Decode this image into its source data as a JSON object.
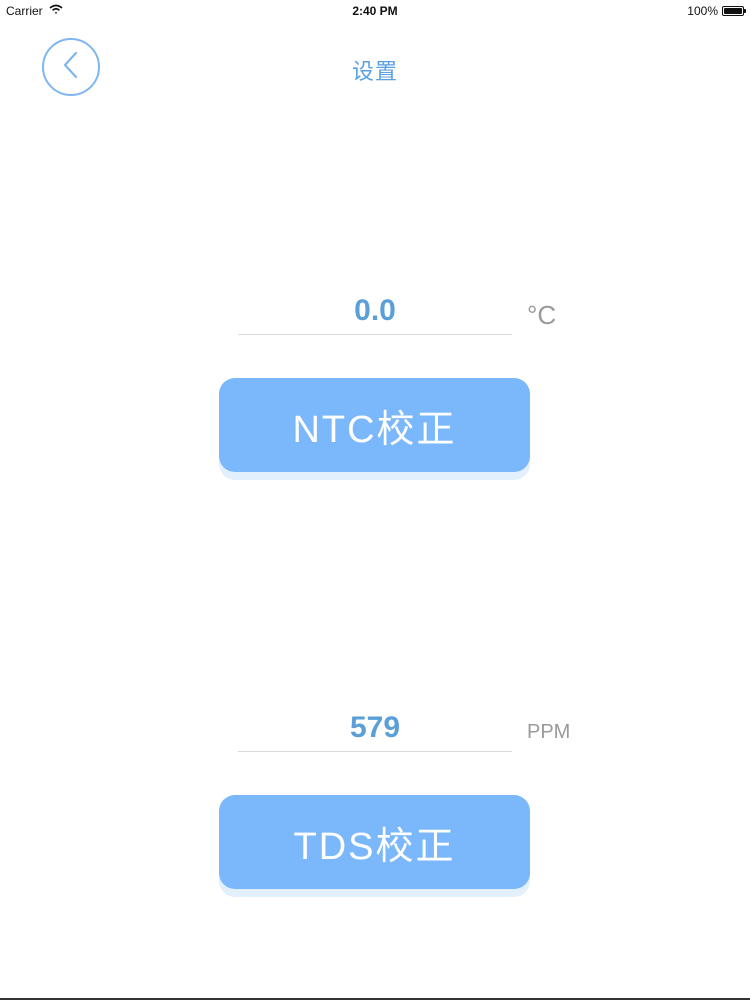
{
  "status_bar": {
    "carrier": "Carrier",
    "time": "2:40 PM",
    "battery": "100%",
    "battery_level": 1.0
  },
  "header": {
    "title": "设置",
    "back_icon": "chevron-left-icon"
  },
  "ntc": {
    "value": "0.0",
    "unit": "°C",
    "button_label": "NTC校正"
  },
  "tds": {
    "value": "579",
    "unit": "PPM",
    "button_label": "TDS校正"
  },
  "colors": {
    "accent": "#5aa1e3",
    "button": "#7ab8fb",
    "value_text": "#5b9fd9",
    "unit_text": "#9a9a9a"
  }
}
